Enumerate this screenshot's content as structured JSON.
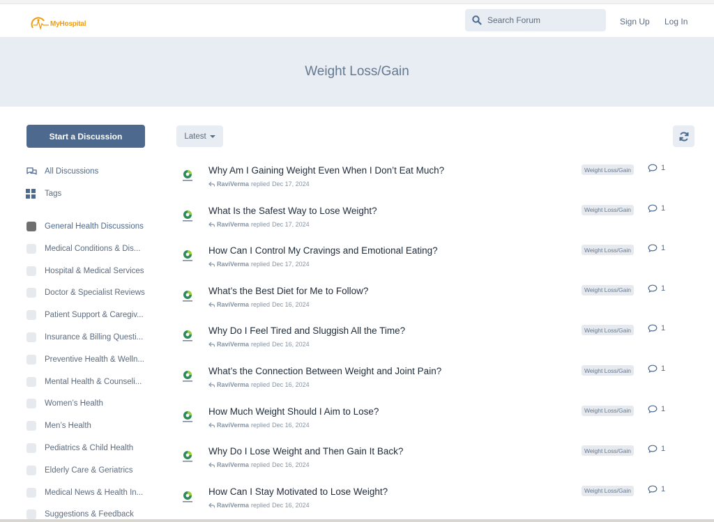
{
  "header": {
    "logo_text": "MyHospital",
    "search_placeholder": "Search Forum",
    "signup_label": "Sign Up",
    "login_label": "Log In"
  },
  "hero": {
    "title": "Weight Loss/Gain"
  },
  "sidebar": {
    "start_label": "Start a Discussion",
    "all_discussions": "All Discussions",
    "tags_label": "Tags",
    "tags": [
      {
        "label": "General Health Discussions",
        "active": true
      },
      {
        "label": "Medical Conditions & Dis..."
      },
      {
        "label": "Hospital & Medical Services"
      },
      {
        "label": "Doctor & Specialist Reviews"
      },
      {
        "label": "Patient Support & Caregiv..."
      },
      {
        "label": "Insurance & Billing Questi..."
      },
      {
        "label": "Preventive Health & Welln..."
      },
      {
        "label": "Mental Health & Counseli..."
      },
      {
        "label": "Women’s Health"
      },
      {
        "label": "Men’s Health"
      },
      {
        "label": "Pediatrics & Child Health"
      },
      {
        "label": "Elderly Care & Geriatrics"
      },
      {
        "label": "Medical News & Health In..."
      },
      {
        "label": "Suggestions & Feedback"
      }
    ]
  },
  "toolbar": {
    "sort_label": "Latest"
  },
  "discussions": [
    {
      "title": "Why Am I Gaining Weight Even When I Don’t Eat Much?",
      "user": "RaviVerma",
      "verb": "replied",
      "date": "Dec 17, 2024",
      "tag": "Weight Loss/Gain",
      "replies": "1"
    },
    {
      "title": "What Is the Safest Way to Lose Weight?",
      "user": "RaviVerma",
      "verb": "replied",
      "date": "Dec 17, 2024",
      "tag": "Weight Loss/Gain",
      "replies": "1"
    },
    {
      "title": "How Can I Control My Cravings and Emotional Eating?",
      "user": "RaviVerma",
      "verb": "replied",
      "date": "Dec 17, 2024",
      "tag": "Weight Loss/Gain",
      "replies": "1"
    },
    {
      "title": "What’s the Best Diet for Me to Follow?",
      "user": "RaviVerma",
      "verb": "replied",
      "date": "Dec 16, 2024",
      "tag": "Weight Loss/Gain",
      "replies": "1"
    },
    {
      "title": "Why Do I Feel Tired and Sluggish All the Time?",
      "user": "RaviVerma",
      "verb": "replied",
      "date": "Dec 16, 2024",
      "tag": "Weight Loss/Gain",
      "replies": "1"
    },
    {
      "title": "What’s the Connection Between Weight and Joint Pain?",
      "user": "RaviVerma",
      "verb": "replied",
      "date": "Dec 16, 2024",
      "tag": "Weight Loss/Gain",
      "replies": "1"
    },
    {
      "title": "How Much Weight Should I Aim to Lose?",
      "user": "RaviVerma",
      "verb": "replied",
      "date": "Dec 16, 2024",
      "tag": "Weight Loss/Gain",
      "replies": "1"
    },
    {
      "title": "Why Do I Lose Weight and Then Gain It Back?",
      "user": "RaviVerma",
      "verb": "replied",
      "date": "Dec 16, 2024",
      "tag": "Weight Loss/Gain",
      "replies": "1"
    },
    {
      "title": "How Can I Stay Motivated to Lose Weight?",
      "user": "RaviVerma",
      "verb": "replied",
      "date": "Dec 16, 2024",
      "tag": "Weight Loss/Gain",
      "replies": "1"
    }
  ]
}
